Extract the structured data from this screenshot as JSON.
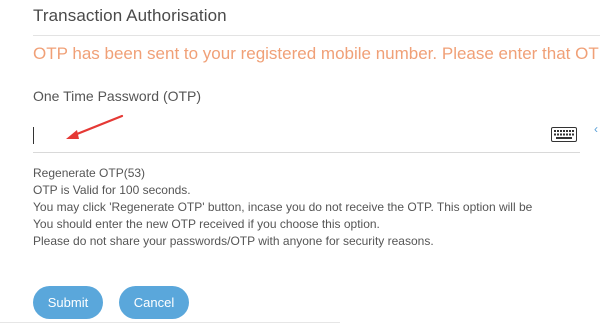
{
  "header": {
    "title": "Transaction Authorisation"
  },
  "notice": {
    "text": "OTP has been sent to your registered mobile number. Please enter that OTP",
    "color": "#f0a077"
  },
  "otp_field": {
    "label": "One Time Password (OTP)",
    "value": "",
    "placeholder": "",
    "keyboard_icon": "virtual-keyboard-icon"
  },
  "info": {
    "regenerate": "Regenerate OTP(53)",
    "lines": [
      "OTP is Valid for 100 seconds.",
      "You may click 'Regenerate OTP' button, incase you do not receive the OTP. This option will be",
      "You should enter the new OTP received if you choose this option.",
      "Please do not share your passwords/OTP with anyone for security reasons."
    ]
  },
  "actions": {
    "submit_label": "Submit",
    "cancel_label": "Cancel"
  },
  "colors": {
    "accent": "#5aa7db",
    "annotation": "#e53935"
  }
}
